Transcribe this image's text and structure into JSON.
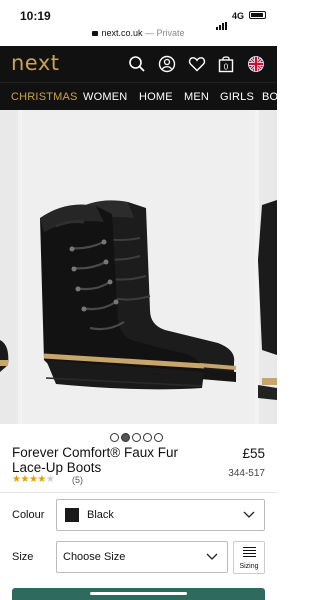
{
  "status_bar": {
    "time": "10:19",
    "network": "4G"
  },
  "browser": {
    "domain": "next.co.uk",
    "separator": " — ",
    "mode": "Private"
  },
  "header": {
    "logo": "next",
    "icons": [
      "search-icon",
      "account-icon",
      "heart-icon",
      "bag-icon",
      "uk-flag-icon"
    ],
    "bag_count": "0"
  },
  "nav": {
    "items": [
      "CHRISTMAS",
      "WOMEN",
      "HOME",
      "MEN",
      "GIRLS",
      "BO"
    ]
  },
  "gallery": {
    "total": 5,
    "active_index": 1
  },
  "product": {
    "title_line1": "Forever Comfort® Faux Fur",
    "title_line2": "Lace-Up Boots",
    "price": "£55",
    "sku": "344-517",
    "rating": 4,
    "rating_max": 5,
    "review_count": "(5)"
  },
  "options": {
    "colour_label": "Colour",
    "colour_value": "Black",
    "size_label": "Size",
    "size_placeholder": "Choose Size",
    "sizing_button": "Sizing"
  },
  "colors": {
    "brand_gold": "#c9a255",
    "header_bg": "#111111",
    "star": "#e1a100",
    "cta": "#2e6b5e"
  }
}
